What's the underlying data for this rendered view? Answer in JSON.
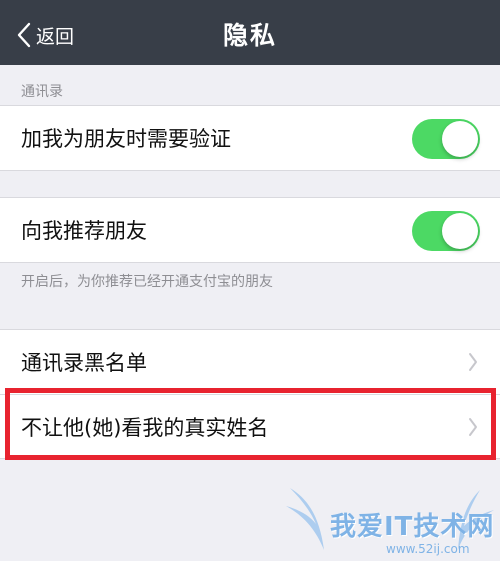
{
  "navbar": {
    "back_label": "返回",
    "title": "隐私"
  },
  "contacts_section": {
    "header": "通讯录"
  },
  "verify_friend": {
    "label": "加我为朋友时需要验证",
    "enabled": true
  },
  "recommend_friends": {
    "label": "向我推荐朋友",
    "enabled": true,
    "note": "开启后，为你推荐已经开通支付宝的朋友"
  },
  "blacklist": {
    "label": "通讯录黑名单"
  },
  "hide_real_name": {
    "label": "不让他(她)看我的真实姓名"
  },
  "watermark": {
    "text": "我爱IT技术网",
    "url": "www.52ij.com"
  },
  "colors": {
    "navbar": "#383e48",
    "toggle_on": "#4cd964",
    "highlight": "#e8232f"
  }
}
